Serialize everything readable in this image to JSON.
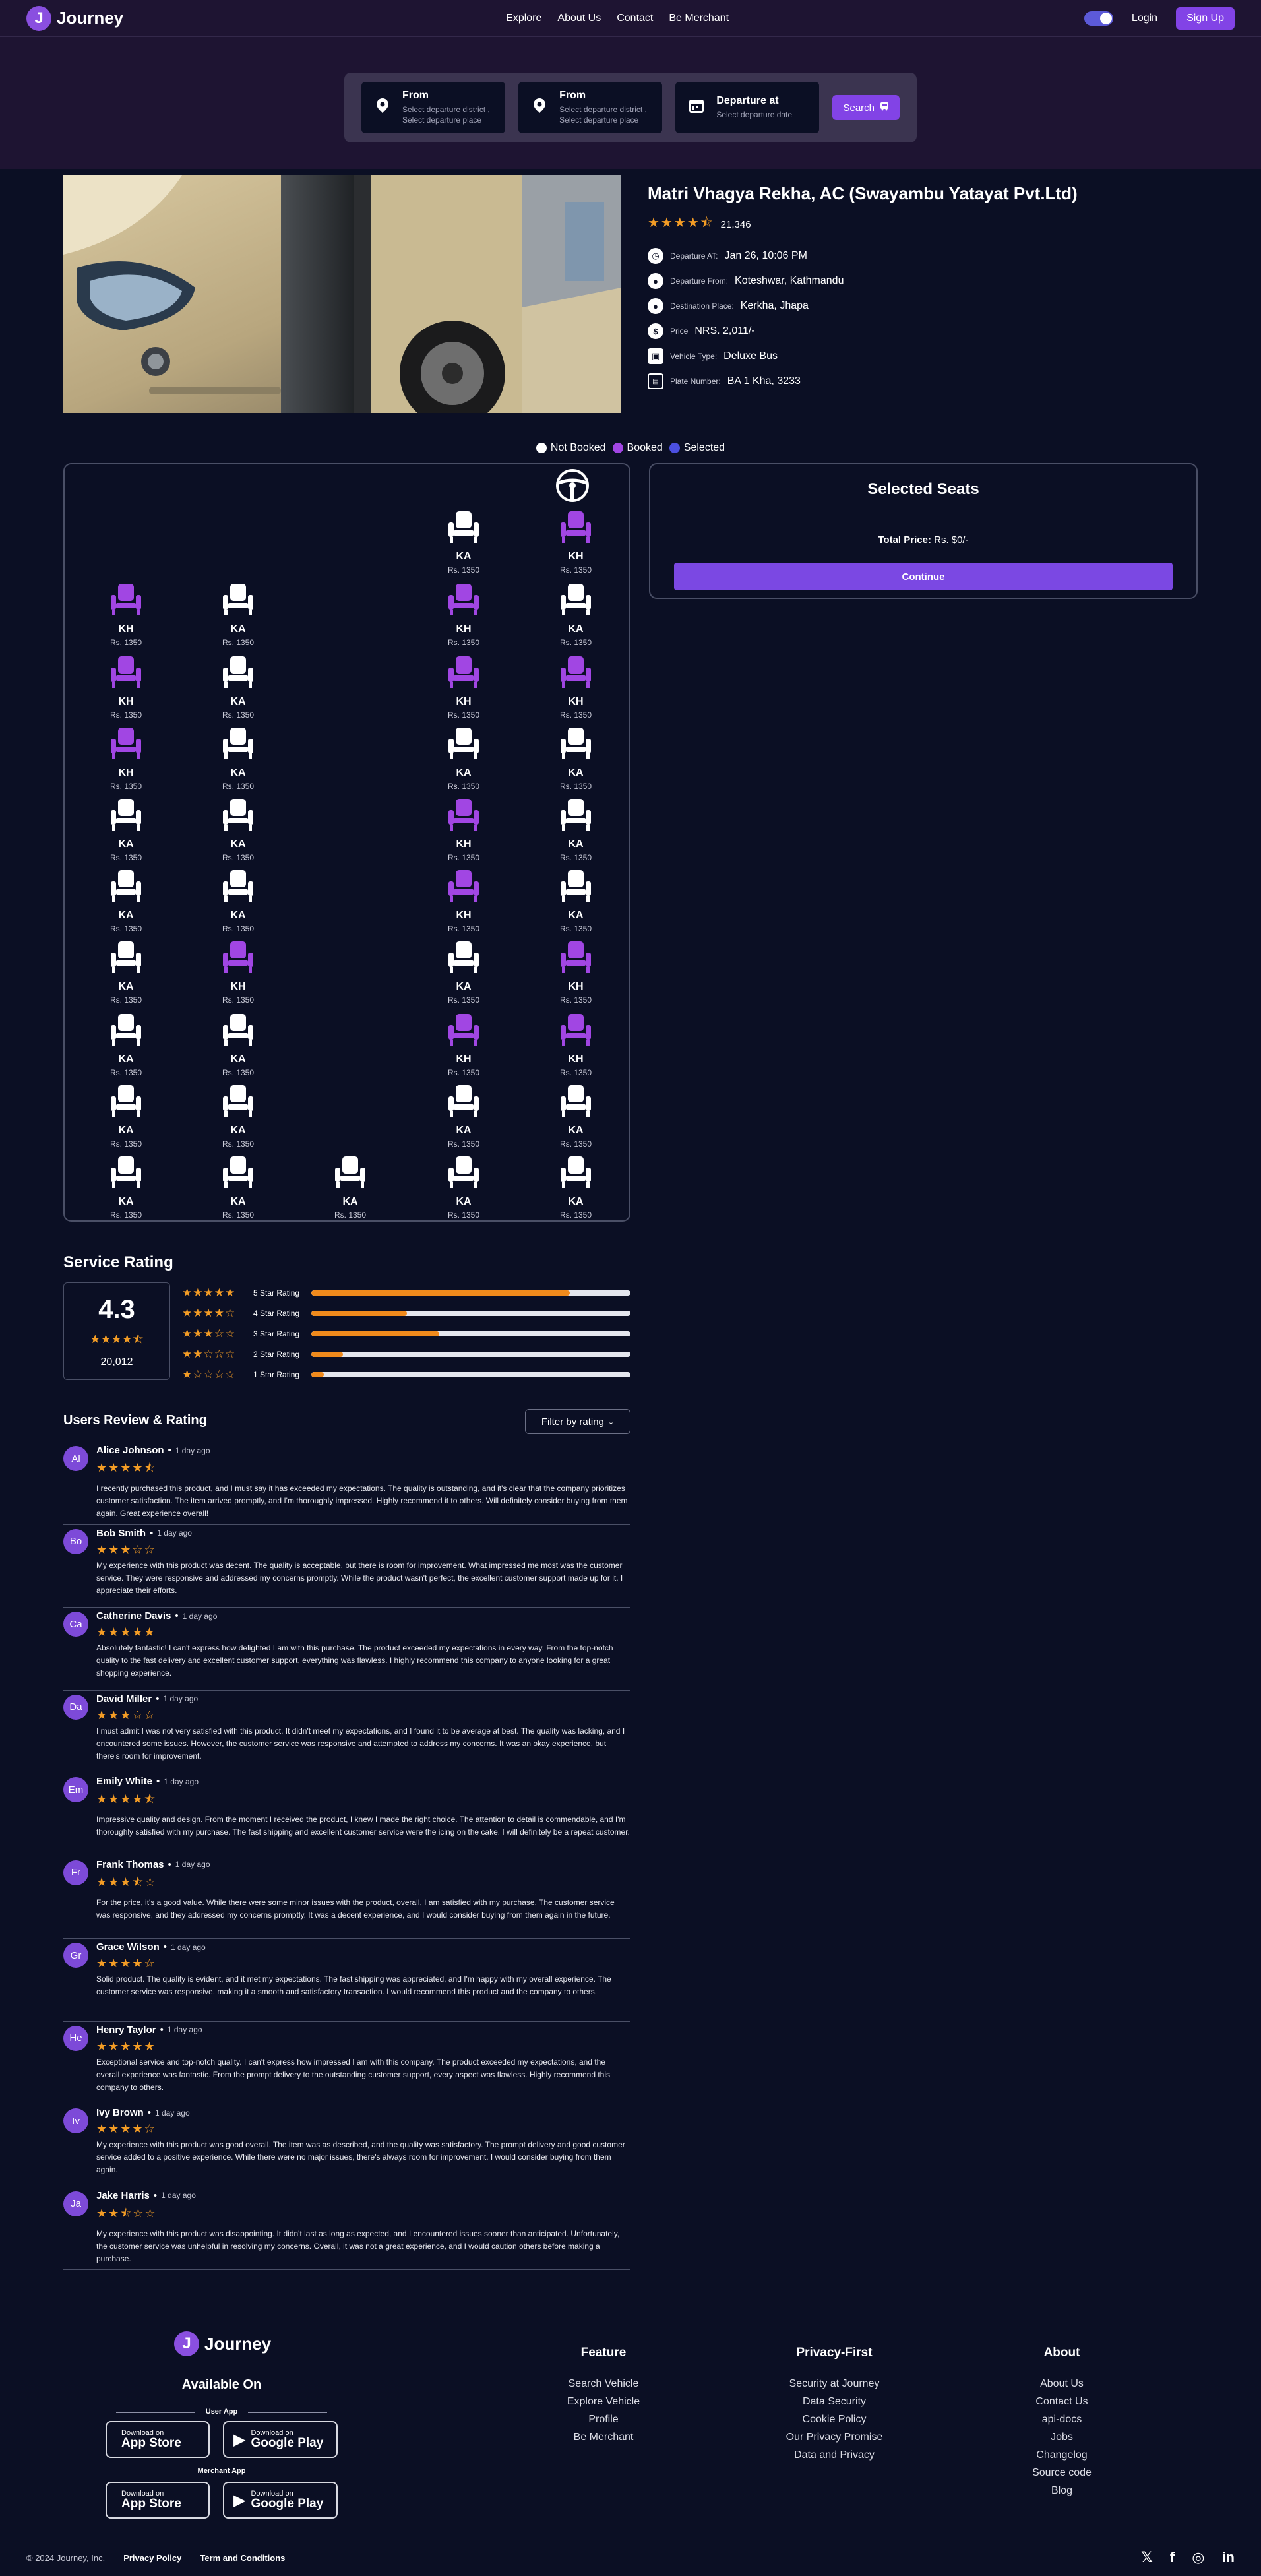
{
  "header": {
    "brand": "Journey",
    "logo_letter": "J",
    "nav": [
      "Explore",
      "About Us",
      "Contact",
      "Be Merchant"
    ],
    "login": "Login",
    "signup": "Sign Up"
  },
  "search": {
    "fields": [
      {
        "title": "From",
        "sub1": "Select departure district ,",
        "sub2": "Select departure place",
        "icon": "location-pin-icon"
      },
      {
        "title": "From",
        "sub1": "Select departure district ,",
        "sub2": "Select departure place",
        "icon": "location-pin-icon"
      },
      {
        "title": "Departure at",
        "sub1": "Select departure date",
        "sub2": "",
        "icon": "calendar-icon"
      }
    ],
    "button": "Search"
  },
  "bus": {
    "title": "Matri Vhagya Rekha, AC (Swayambu Yatayat Pvt.Ltd)",
    "rating_count": "21,346",
    "details": [
      {
        "label": "Departure AT:",
        "value": "Jan 26, 10:06 PM",
        "icon": "clock-icon"
      },
      {
        "label": "Departure From:",
        "value": "Koteshwar, Kathmandu",
        "icon": "location-pin-icon"
      },
      {
        "label": "Destination Place:",
        "value": "Kerkha, Jhapa",
        "icon": "location-pin-icon"
      },
      {
        "label": "Price",
        "value": "NRS. 2,011/-",
        "icon": "dollar-icon"
      },
      {
        "label": "Vehicle Type:",
        "value": "Deluxe Bus",
        "icon": "bus-icon"
      },
      {
        "label": "Plate Number:",
        "value": "BA 1 Kha, 3233",
        "icon": "id-card-icon"
      }
    ]
  },
  "legend": [
    "Not Booked",
    "Booked",
    "Selected"
  ],
  "colors": {
    "not_booked": "#ffffff",
    "booked": "#a146e3",
    "selected": "#4b4fe0",
    "accent": "#8243e6",
    "star": "#f39c25"
  },
  "seats": {
    "price": "Rs. 1350",
    "rows": [
      [
        null,
        null,
        null,
        "KA-free",
        "KH-booked"
      ],
      [
        "KH-booked",
        "KA-free",
        null,
        "KH-booked",
        "KA-free"
      ],
      [
        "KH-booked",
        "KA-free",
        null,
        "KH-booked",
        "KH-booked"
      ],
      [
        "KH-booked",
        "KA-free",
        null,
        "KA-free",
        "KA-free"
      ],
      [
        "KA-free",
        "KA-free",
        null,
        "KH-booked",
        "KA-free"
      ],
      [
        "KA-free",
        "KA-free",
        null,
        "KH-booked",
        "KA-free"
      ],
      [
        "KA-free",
        "KH-booked",
        null,
        "KA-free",
        "KH-booked"
      ],
      [
        "KA-free",
        "KA-free",
        null,
        "KH-booked",
        "KH-booked"
      ],
      [
        "KA-free",
        "KA-free",
        null,
        "KA-free",
        "KA-free"
      ],
      [
        "KA-free",
        "KA-free",
        "KA-free",
        "KA-free",
        "KA-free"
      ]
    ]
  },
  "selected_panel": {
    "title": "Selected Seats",
    "total_label": "Total Price:",
    "total_value": "Rs. $0/-",
    "continue": "Continue"
  },
  "service_rating": {
    "title": "Service Rating",
    "value": "4.3",
    "count": "20,012",
    "bars": [
      {
        "label": "5 Star Rating",
        "stars": 5,
        "fraction": 0.81
      },
      {
        "label": "4 Star Rating",
        "stars": 4,
        "fraction": 0.3
      },
      {
        "label": "3 Star Rating",
        "stars": 3,
        "fraction": 0.4
      },
      {
        "label": "2 Star Rating",
        "stars": 2,
        "fraction": 0.1
      },
      {
        "label": "1 Star Rating",
        "stars": 1,
        "fraction": 0.04
      }
    ]
  },
  "reviews_section": {
    "title": "Users Review & Rating",
    "filter": "Filter by rating"
  },
  "reviews": [
    {
      "initials": "Al",
      "name": "Alice Johnson",
      "time": "1 day ago",
      "stars": "★★★★⯪",
      "text": "I recently purchased this product, and I must say it has exceeded my expectations. The quality is outstanding, and it's clear that the company prioritizes customer satisfaction. The item arrived promptly, and I'm thoroughly impressed. Highly recommend it to others. Will definitely consider buying from them again. Great experience overall!"
    },
    {
      "initials": "Bo",
      "name": "Bob Smith",
      "time": "1 day ago",
      "stars": "★★★☆☆",
      "text": "My experience with this product was decent. The quality is acceptable, but there is room for improvement. What impressed me most was the customer service. They were responsive and addressed my concerns promptly. While the product wasn't perfect, the excellent customer support made up for it. I appreciate their efforts."
    },
    {
      "initials": "Ca",
      "name": "Catherine Davis",
      "time": "1 day ago",
      "stars": "★★★★★",
      "text": "Absolutely fantastic! I can't express how delighted I am with this purchase. The product exceeded my expectations in every way. From the top-notch quality to the fast delivery and excellent customer support, everything was flawless. I highly recommend this company to anyone looking for a great shopping experience."
    },
    {
      "initials": "Da",
      "name": "David Miller",
      "time": "1 day ago",
      "stars": "★★★☆☆",
      "text": "I must admit I was not very satisfied with this product. It didn't meet my expectations, and I found it to be average at best. The quality was lacking, and I encountered some issues. However, the customer service was responsive and attempted to address my concerns. It was an okay experience, but there's room for improvement."
    },
    {
      "initials": "Em",
      "name": "Emily White",
      "time": "1 day ago",
      "stars": "★★★★⯪",
      "text": "Impressive quality and design. From the moment I received the product, I knew I made the right choice. The attention to detail is commendable, and I'm thoroughly satisfied with my purchase. The fast shipping and excellent customer service were the icing on the cake. I will definitely be a repeat customer."
    },
    {
      "initials": "Fr",
      "name": "Frank Thomas",
      "time": "1 day ago",
      "stars": "★★★⯪☆",
      "text": "For the price, it's a good value. While there were some minor issues with the product, overall, I am satisfied with my purchase. The customer service was responsive, and they addressed my concerns promptly. It was a decent experience, and I would consider buying from them again in the future."
    },
    {
      "initials": "Gr",
      "name": "Grace Wilson",
      "time": "1 day ago",
      "stars": "★★★★☆",
      "text": "Solid product. The quality is evident, and it met my expectations. The fast shipping was appreciated, and I'm happy with my overall experience. The customer service was responsive, making it a smooth and satisfactory transaction. I would recommend this product and the company to others."
    },
    {
      "initials": "He",
      "name": "Henry Taylor",
      "time": "1 day ago",
      "stars": "★★★★★",
      "text": "Exceptional service and top-notch quality. I can't express how impressed I am with this company. The product exceeded my expectations, and the overall experience was fantastic. From the prompt delivery to the outstanding customer support, every aspect was flawless. Highly recommend this company to others."
    },
    {
      "initials": "Iv",
      "name": "Ivy Brown",
      "time": "1 day ago",
      "stars": "★★★★☆",
      "text": "My experience with this product was good overall. The item was as described, and the quality was satisfactory. The prompt delivery and good customer service added to a positive experience. While there were no major issues, there's always room for improvement. I would consider buying from them again."
    },
    {
      "initials": "Ja",
      "name": "Jake Harris",
      "time": "1 day ago",
      "stars": "★★⯪☆☆",
      "text": "My experience with this product was disappointing. It didn't last as long as expected, and I encountered issues sooner than anticipated. Unfortunately, the customer service was unhelpful in resolving my concerns. Overall, it was not a great experience, and I would caution others before making a purchase."
    }
  ],
  "footer": {
    "brand": "Journey",
    "available_on": "Available On",
    "user_app": "User App",
    "merchant_app": "Merchant App",
    "download_on": "Download on",
    "app_store": "App Store",
    "google_play": "Google Play",
    "columns": [
      {
        "title": "Feature",
        "links": [
          "Search Vehicle",
          "Explore Vehicle",
          "Profile",
          "Be Merchant"
        ]
      },
      {
        "title": "Privacy-First",
        "links": [
          "Security at Journey",
          "Data Security",
          "Cookie Policy",
          "Our Privacy Promise",
          "Data and Privacy"
        ]
      },
      {
        "title": "About",
        "links": [
          "About Us",
          "Contact Us",
          "api-docs",
          "Jobs",
          "Changelog",
          "Source code",
          "Blog"
        ]
      }
    ],
    "copyright": "© 2024 Journey, Inc.",
    "privacy": "Privacy Policy",
    "terms": "Term and Conditions",
    "socials": [
      "x-icon",
      "facebook-icon",
      "instagram-icon",
      "linkedin-icon"
    ]
  }
}
